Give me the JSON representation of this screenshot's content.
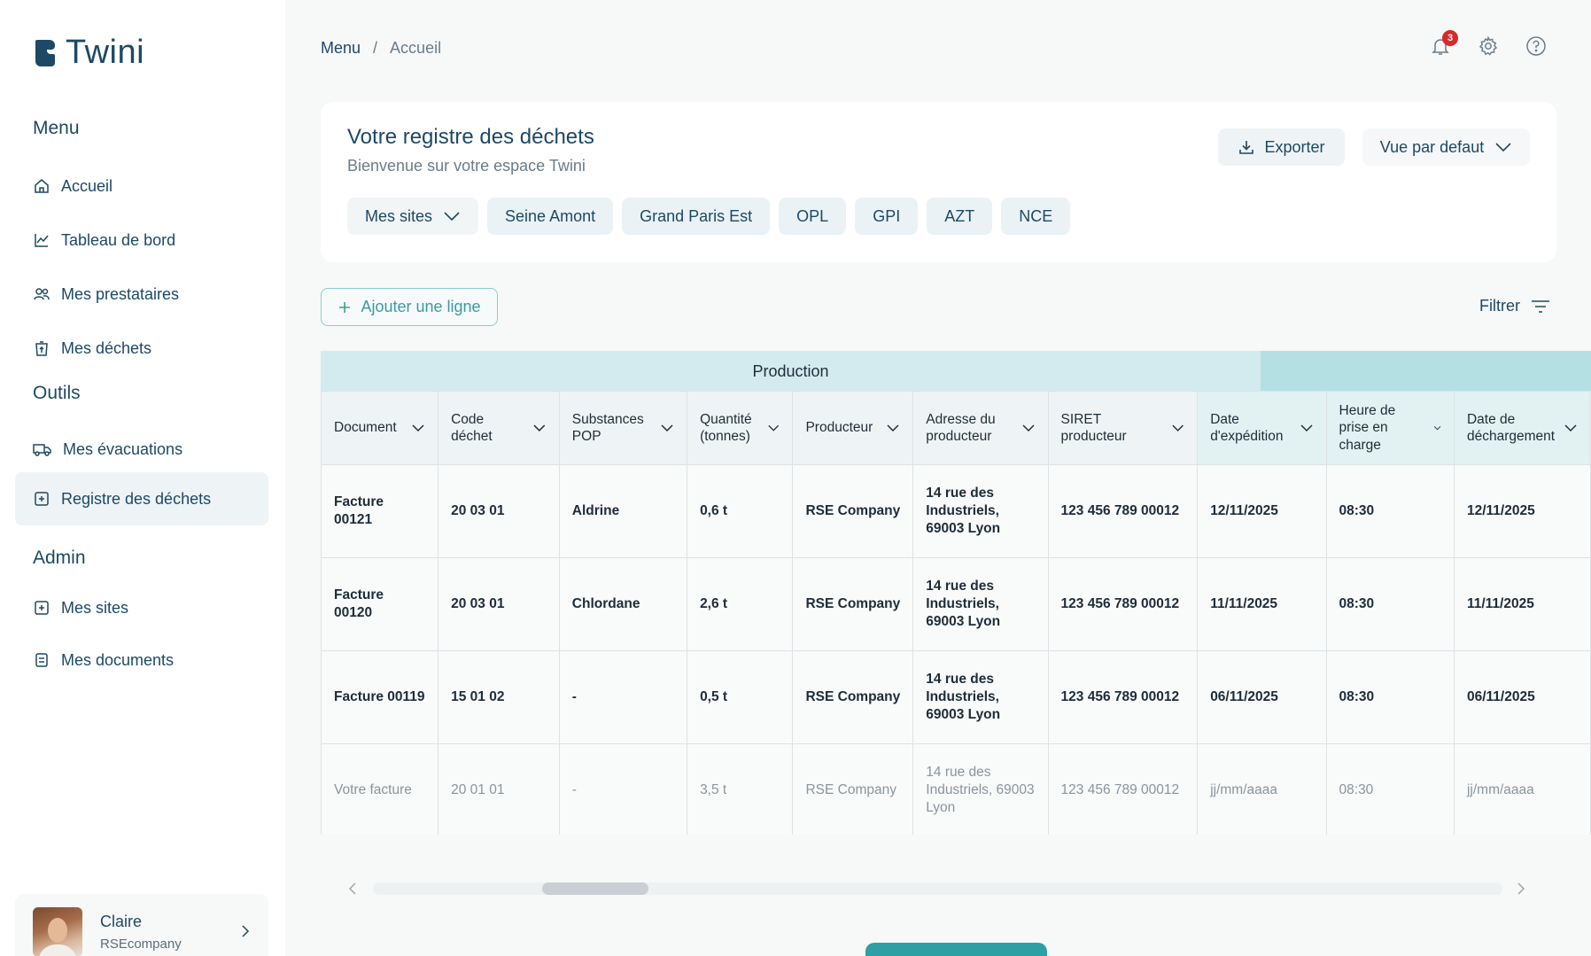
{
  "brand": {
    "name": "Twini"
  },
  "sidebar": {
    "menu_title": "Menu",
    "menu_items": [
      {
        "label": "Accueil",
        "icon": "home-icon"
      },
      {
        "label": "Tableau de bord",
        "icon": "chart-line-icon"
      },
      {
        "label": "Mes prestataires",
        "icon": "users-icon"
      },
      {
        "label": "Mes déchets",
        "icon": "recycle-bin-icon"
      }
    ],
    "tools_title": "Outils",
    "tools_items": [
      {
        "label": "Mes évacuations",
        "icon": "truck-icon"
      },
      {
        "label": "Registre des déchets",
        "icon": "register-icon",
        "active": true
      }
    ],
    "admin_title": "Admin",
    "admin_items": [
      {
        "label": "Mes sites",
        "icon": "site-icon"
      },
      {
        "label": "Mes documents",
        "icon": "document-icon"
      }
    ]
  },
  "user": {
    "name": "Claire",
    "company": "RSEcompany"
  },
  "topbar": {
    "breadcrumb": [
      "Menu",
      "Accueil"
    ],
    "notifications_count": "3"
  },
  "header": {
    "title": "Votre registre des déchets",
    "subtitle": "Bienvenue sur votre espace Twini",
    "export_label": "Exporter",
    "view_label": "Vue par defaut",
    "sites_label": "Mes sites",
    "site_chips": [
      "Seine Amont",
      "Grand Paris Est",
      "OPL",
      "GPI",
      "AZT",
      "NCE"
    ]
  },
  "actions": {
    "add_label": "Ajouter une ligne",
    "filter_label": "Filtrer"
  },
  "table": {
    "group_production": "Production",
    "columns": [
      {
        "label": "Document"
      },
      {
        "label": "Code déchet"
      },
      {
        "label": "Substances POP"
      },
      {
        "label": "Quantité (tonnes)"
      },
      {
        "label": "Producteur"
      },
      {
        "label": "Adresse du producteur"
      },
      {
        "label": "SIRET producteur"
      },
      {
        "label": "Date d'expédition"
      },
      {
        "label": "Heure de prise en charge"
      },
      {
        "label": "Date de déchargement"
      }
    ],
    "rows": [
      [
        "Facture 00121",
        "20 03 01",
        "Aldrine",
        "0,6 t",
        "RSE Company",
        "14 rue des Industriels, 69003 Lyon",
        "123 456 789 00012",
        "12/11/2025",
        "08:30",
        "12/11/2025"
      ],
      [
        "Facture 00120",
        "20 03 01",
        "Chlordane",
        "2,6 t",
        "RSE Company",
        "14 rue des Industriels, 69003 Lyon",
        "123 456 789 00012",
        "11/11/2025",
        "08:30",
        "11/11/2025"
      ],
      [
        "Facture 00119",
        "15 01 02",
        "-",
        "0,5 t",
        "RSE Company",
        "14 rue des Industriels, 69003 Lyon",
        "123 456 789 00012",
        "06/11/2025",
        "08:30",
        "06/11/2025"
      ]
    ],
    "placeholder_row": [
      "Votre facture",
      "20 01 01",
      "-",
      "3,5 t",
      "RSE Company",
      "14 rue des Industriels, 69003 Lyon",
      "123 456 789 00012",
      "jj/mm/aaaa",
      "08:30",
      "jj/mm/aaaa"
    ]
  },
  "colors": {
    "brand": "#1d4966",
    "accent": "#2e9fa3",
    "group_production": "#d3ebee",
    "group_next": "#b4e0e3",
    "badge": "#d52b2b"
  }
}
